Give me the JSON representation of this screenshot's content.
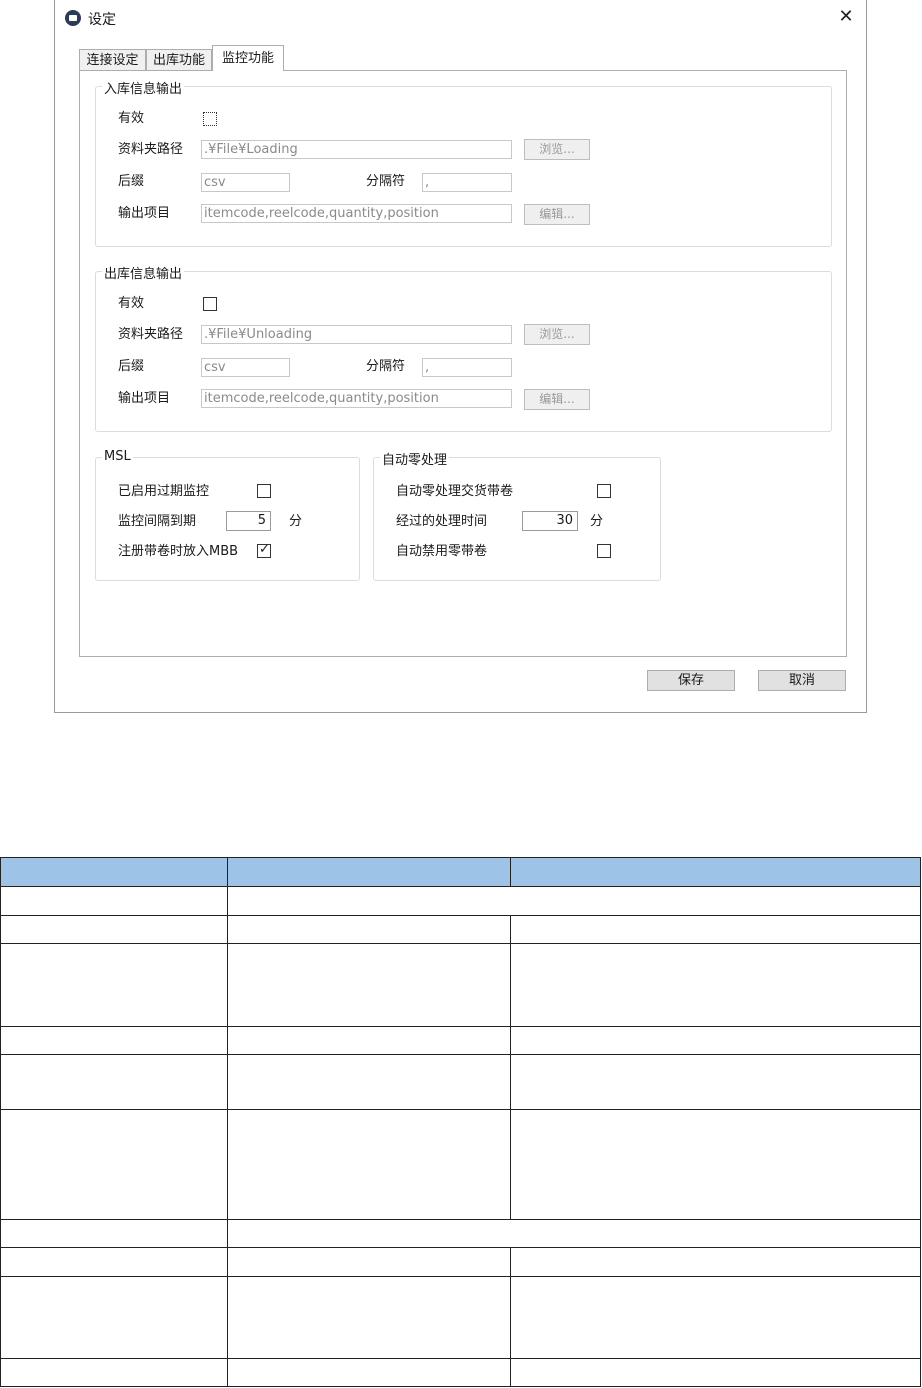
{
  "window": {
    "title": "设定"
  },
  "tabs": [
    {
      "label": "连接设定",
      "active": false
    },
    {
      "label": "出库功能",
      "active": false
    },
    {
      "label": "监控功能",
      "active": true
    }
  ],
  "inbound": {
    "legend": "入库信息输出",
    "valid_label": "有效",
    "valid_checked": false,
    "folder_label": "资料夹路径",
    "folder_value": ".¥File¥Loading",
    "browse_label": "浏览...",
    "suffix_label": "后缀",
    "suffix_value": "csv",
    "separator_label": "分隔符",
    "separator_value": ",",
    "items_label": "输出项目",
    "items_value": "itemcode,reelcode,quantity,position",
    "edit_label": "编辑..."
  },
  "outbound": {
    "legend": "出库信息输出",
    "valid_label": "有效",
    "valid_checked": false,
    "folder_label": "资料夹路径",
    "folder_value": ".¥File¥Unloading",
    "browse_label": "浏览...",
    "suffix_label": "后缀",
    "suffix_value": "csv",
    "separator_label": "分隔符",
    "separator_value": ",",
    "items_label": "输出项目",
    "items_value": "itemcode,reelcode,quantity,position",
    "edit_label": "编辑..."
  },
  "msl": {
    "legend": "MSL",
    "expiry_label": "已启用过期监控",
    "expiry_checked": false,
    "interval_label": "监控间隔到期",
    "interval_value": "5",
    "interval_unit": "分",
    "mbb_label": "注册带卷时放入MBB",
    "mbb_checked": true
  },
  "auto_zero": {
    "legend": "自动零处理",
    "tape_label": "自动零处理交货带卷",
    "tape_checked": false,
    "elapsed_label": "经过的处理时间",
    "elapsed_value": "30",
    "elapsed_unit": "分",
    "disable_label": "自动禁用零带卷",
    "disable_checked": false
  },
  "footer": {
    "save_label": "保存",
    "cancel_label": "取消"
  },
  "colors": {
    "table_header": "#9dc3e6"
  }
}
